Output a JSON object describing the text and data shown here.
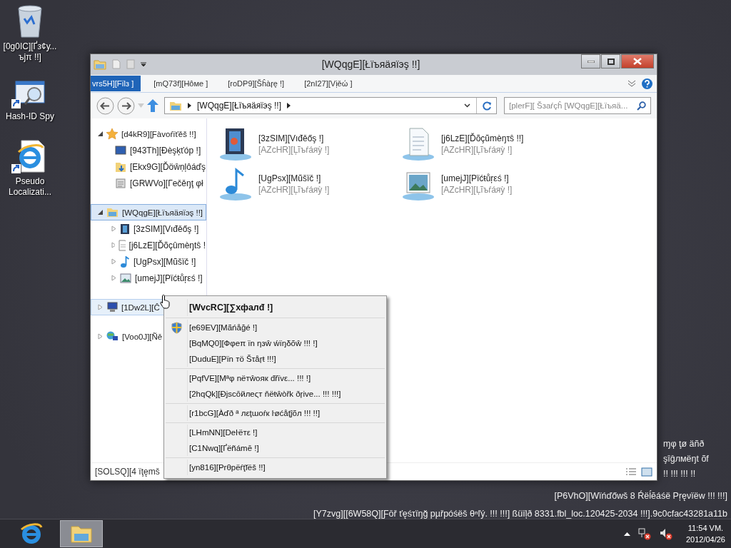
{
  "desktop_icons": [
    {
      "kind": "recycle-bin",
      "label": "[0g0IC][Ґз¢у... ъјπ !!]",
      "shortcut": false
    },
    {
      "kind": "app",
      "label": "Hash-ID Spy",
      "shortcut": true
    },
    {
      "kind": "browser-doc",
      "label": "Pseudo Localizati...",
      "shortcut": true
    }
  ],
  "side_text": [
    "ɱφ ţø äñð",
    "şîĝлмëŋt õf",
    "!! !!! !!! !!"
  ],
  "build_info": [
    "[P6VhO][Wïńďőwš 8 Ŕëĺĕáśë Pŗęνïëw !!! !!!]",
    "[Y7zvg][[6W58Q][Ƒōř ťęśτïŋğ pµřpóśëš θⁿľý. !!! !!!] ßüïļð 8331.fbl_loc.120425-2034 !!!].9c0cfac43281a11b"
  ],
  "window": {
    "title": "[WQqgE][Łïъяäяïэş !!]"
  },
  "ribbon_tabs": [
    {
      "label": "vrs5H][Fïlз ]",
      "selected": true
    },
    {
      "label": "[mQ73f][Hôмe ]",
      "selected": false
    },
    {
      "label": "[roDP9][Šĥàŗę !]",
      "selected": false
    },
    {
      "label": "[2nI27][Vịěώ ]",
      "selected": false
    }
  ],
  "address": {
    "breadcrumb": "[WQqgE][Łïъяäяïэş !!]"
  },
  "search": {
    "placeholder": "[plerF][ Šзаŕçĥ [WQqgE][Łïъяä..."
  },
  "nav_tree": [
    {
      "kind": "favorites",
      "label": "[d4kR9][Ƒàvoŕïťěš !!]",
      "expanded": true,
      "selected": false,
      "hovered": false,
      "children": [
        {
          "kind": "desktop",
          "label": "[943Th][Đèşķťóp !]"
        },
        {
          "kind": "downloads",
          "label": "[Ekx9G][Ďöŵṇļôáďş"
        },
        {
          "kind": "recent",
          "label": "[GRWVo][Гečěŋţ φł"
        }
      ]
    },
    {
      "kind": "libraries",
      "label": "[WQqgE][Łïъяäяïэş !!]",
      "expanded": true,
      "selected": true,
      "hovered": false,
      "children": [
        {
          "kind": "videos",
          "label": "[3zSIM][Vıđěőş !]",
          "expanded": false
        },
        {
          "kind": "documents",
          "label": "[j6LzE][Ďõçûmèŋtŝ !",
          "expanded": false
        },
        {
          "kind": "music",
          "label": "[UgPsx][Mũšïč !]",
          "expanded": false
        },
        {
          "kind": "pictures",
          "label": "[umejJ][Pïćŧůŗεś !]",
          "expanded": false
        }
      ]
    },
    {
      "kind": "computer",
      "label": "[1Dw2L][Ĉ",
      "expanded": false,
      "selected": false,
      "hovered": true
    },
    {
      "kind": "network",
      "label": "[Voo0J][Ñě",
      "expanded": false,
      "selected": false,
      "hovered": false
    }
  ],
  "content_items": [
    {
      "kind": "videos",
      "name": "[3zSIM][Vıđěőş !]",
      "subtitle": "[AZcHR][Ļĩъŕáяỳ !]"
    },
    {
      "kind": "documents",
      "name": "[j6LzE][Ďõçũmèŋτŝ !!]",
      "subtitle": "[AZcHR][Ļĩъŕáяỳ !]"
    },
    {
      "kind": "music",
      "name": "[UgPsx][Mũšïč !]",
      "subtitle": "[AZcHR][Ļĩъŕáяỳ !]"
    },
    {
      "kind": "pictures",
      "name": "[umejJ][Pïćŧůŗεś !]",
      "subtitle": "[AZcHR][Ļĩъŕáяỳ !]"
    }
  ],
  "status_bar": {
    "text": "[SOLSQ][4 ïţęmš"
  },
  "context_menu": [
    [
      {
        "label": "[WvcRC][∑хфалđ !]",
        "kind": "default"
      }
    ],
    [
      {
        "label": "[e69EV][Mãńåğé !]",
        "kind": "admin"
      },
      {
        "label": "[BqMQ0][Фφeπ ïn ηзŵ ẃïŋδõŵ !!! !]",
        "kind": "plain"
      },
      {
        "label": "[DuduE][Pïn тö Šτåŗŧ !!!]",
        "kind": "plain"
      }
    ],
    [
      {
        "label": "[PqfVE][Mªφ nëтŵояк đřïvε... !!! !]",
        "kind": "plain"
      },
      {
        "label": "[2hqQk][Ðjscōйлeςт ňëŧŵòřk ðŗive... !!! !!!]",
        "kind": "plain"
      }
    ],
    [
      {
        "label": "[r1bcG][Àďð ª лεţɯoŕк ŀøćåţĵõл !!! !!]",
        "kind": "plain"
      }
    ],
    [
      {
        "label": "[LHmNN][Deŀëтε !]",
        "kind": "plain"
      },
      {
        "label": "[C1Nwq][Ґëñámē !]",
        "kind": "plain"
      }
    ],
    [
      {
        "label": "[yn816][Prθpëŕţĭëš !!]",
        "kind": "plain"
      }
    ]
  ],
  "taskbar": {
    "buttons": [
      {
        "kind": "browser",
        "active": false
      },
      {
        "kind": "explorer",
        "active": true
      }
    ],
    "clock": {
      "time": "11:54 VM.",
      "date": "2012/04/26"
    }
  }
}
